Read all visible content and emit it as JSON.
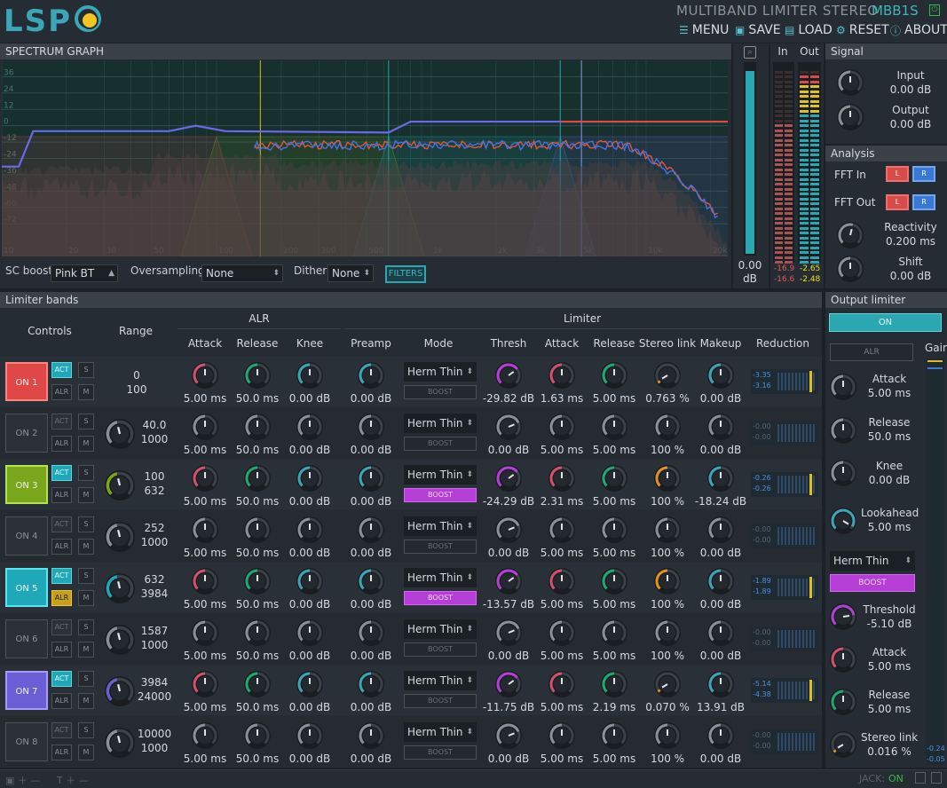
{
  "header": {
    "logo": "LSP",
    "plugin_title": "MULTIBAND LIMITER STEREO",
    "plugin_code": "MBB1S",
    "menu": [
      {
        "icon": "menu-icon",
        "label": "MENU"
      },
      {
        "icon": "save-icon",
        "label": "SAVE"
      },
      {
        "icon": "load-icon",
        "label": "LOAD"
      },
      {
        "icon": "reset-icon",
        "label": "RESET"
      },
      {
        "icon": "about-icon",
        "label": "ABOUT"
      }
    ]
  },
  "spectrum": {
    "title": "SPECTRUM GRAPH",
    "db_ticks": [
      "36",
      "24",
      "12",
      "0",
      "-12",
      "-24",
      "-36",
      "-48",
      "-60",
      "-72"
    ],
    "freq_ticks": [
      "10",
      "20",
      "30",
      "50",
      "100",
      "200",
      "300",
      "500",
      "1k",
      "2k",
      "3k",
      "5k",
      "10k",
      "20k"
    ],
    "sc_boost_label": "SC boost:",
    "sc_boost_value": "Pink BT",
    "oversampling_label": "Oversampling:",
    "oversampling_value": "None",
    "dither_label": "Dither:",
    "dither_value": "None",
    "filters_label": "FILTERS",
    "level_value": "0.00",
    "level_unit": "dB"
  },
  "meters": {
    "in_label": "In",
    "out_label": "Out",
    "in_peaks": [
      "-16.9",
      "-16.6"
    ],
    "out_peaks": [
      "-2.65",
      "-2.48"
    ]
  },
  "signal": {
    "title": "Signal",
    "input_label": "Input",
    "input_value": "0.00 dB",
    "output_label": "Output",
    "output_value": "0.00 dB"
  },
  "analysis": {
    "title": "Analysis",
    "fft_in_label": "FFT In",
    "fft_out_label": "FFT Out",
    "l_label": "L",
    "r_label": "R",
    "reactivity_label": "Reactivity",
    "reactivity_value": "0.200 ms",
    "shift_label": "Shift",
    "shift_value": "0.00 dB"
  },
  "bands": {
    "title": "Limiter bands",
    "col_controls": "Controls",
    "col_range": "Range",
    "group_alr": "ALR",
    "group_limiter": "Limiter",
    "cols": [
      "Attack",
      "Release",
      "Knee",
      "Preamp",
      "Mode",
      "Thresh",
      "Attack",
      "Release",
      "Stereo link",
      "Makeup",
      "Reduction"
    ],
    "act_label": "ACT",
    "alr_label": "ALR",
    "s_label": "S",
    "m_label": "M",
    "boost_label": "BOOST",
    "rows": [
      {
        "on": "ON 1",
        "active": true,
        "color": "#e04848",
        "range_hi": "0",
        "range_lo": "100",
        "range_knob": false,
        "alr_attack": "5.00 ms",
        "alr_release": "50.0 ms",
        "alr_knee": "0.00 dB",
        "preamp": "0.00 dB",
        "mode": "Herm Thin",
        "boost": false,
        "thresh": "-29.82 dB",
        "attack": "1.63 ms",
        "release": "5.00 ms",
        "stereo_link": "0.763 %",
        "makeup": "0.00 dB",
        "red_l": "-3.35",
        "red_r": "-3.16",
        "act_color": "#1fa8b8",
        "alr_active": false
      },
      {
        "on": "ON 2",
        "active": false,
        "color": "#3a4148",
        "range_hi": "40.0",
        "range_lo": "1000",
        "range_knob": true,
        "alr_attack": "5.00 ms",
        "alr_release": "50.0 ms",
        "alr_knee": "0.00 dB",
        "preamp": "0.00 dB",
        "mode": "Herm Thin",
        "boost": false,
        "thresh": "0.00 dB",
        "attack": "5.00 ms",
        "release": "5.00 ms",
        "stereo_link": "100 %",
        "makeup": "0.00 dB",
        "red_l": "-0.00",
        "red_r": "-0.00",
        "act_color": "#2b3137",
        "alr_active": false
      },
      {
        "on": "ON 3",
        "active": true,
        "color": "#7aa61c",
        "range_hi": "100",
        "range_lo": "632",
        "range_knob": true,
        "alr_attack": "5.00 ms",
        "alr_release": "50.0 ms",
        "alr_knee": "0.00 dB",
        "preamp": "0.00 dB",
        "mode": "Herm Thin",
        "boost": true,
        "thresh": "-24.29 dB",
        "attack": "2.31 ms",
        "release": "5.00 ms",
        "stereo_link": "100 %",
        "makeup": "-18.24 dB",
        "red_l": "-0.26",
        "red_r": "-0.26",
        "act_color": "#1fa8b8",
        "alr_active": false
      },
      {
        "on": "ON 4",
        "active": false,
        "color": "#3a4148",
        "range_hi": "252",
        "range_lo": "1000",
        "range_knob": true,
        "alr_attack": "5.00 ms",
        "alr_release": "50.0 ms",
        "alr_knee": "0.00 dB",
        "preamp": "0.00 dB",
        "mode": "Herm Thin",
        "boost": false,
        "thresh": "0.00 dB",
        "attack": "5.00 ms",
        "release": "5.00 ms",
        "stereo_link": "100 %",
        "makeup": "0.00 dB",
        "red_l": "-0.00",
        "red_r": "-0.00",
        "act_color": "#2b3137",
        "alr_active": false
      },
      {
        "on": "ON 5",
        "active": true,
        "color": "#1fa8b8",
        "range_hi": "632",
        "range_lo": "3984",
        "range_knob": true,
        "alr_attack": "5.00 ms",
        "alr_release": "50.0 ms",
        "alr_knee": "0.00 dB",
        "preamp": "0.00 dB",
        "mode": "Herm Thin",
        "boost": true,
        "thresh": "-13.57 dB",
        "attack": "5.00 ms",
        "release": "5.00 ms",
        "stereo_link": "100 %",
        "makeup": "0.00 dB",
        "red_l": "-1.89",
        "red_r": "-1.89",
        "act_color": "#1fa8b8",
        "alr_active": true
      },
      {
        "on": "ON 6",
        "active": false,
        "color": "#3a4148",
        "range_hi": "1587",
        "range_lo": "1000",
        "range_knob": true,
        "alr_attack": "5.00 ms",
        "alr_release": "50.0 ms",
        "alr_knee": "0.00 dB",
        "preamp": "0.00 dB",
        "mode": "Herm Thin",
        "boost": false,
        "thresh": "0.00 dB",
        "attack": "5.00 ms",
        "release": "5.00 ms",
        "stereo_link": "100 %",
        "makeup": "0.00 dB",
        "red_l": "-0.00",
        "red_r": "-0.00",
        "act_color": "#2b3137",
        "alr_active": false
      },
      {
        "on": "ON 7",
        "active": true,
        "color": "#6a5ed4",
        "range_hi": "3984",
        "range_lo": "24000",
        "range_knob": true,
        "alr_attack": "5.00 ms",
        "alr_release": "50.0 ms",
        "alr_knee": "0.00 dB",
        "preamp": "0.00 dB",
        "mode": "Herm Thin",
        "boost": false,
        "thresh": "-11.75 dB",
        "attack": "5.00 ms",
        "release": "2.19 ms",
        "stereo_link": "0.070 %",
        "makeup": "13.91 dB",
        "red_l": "-5.14",
        "red_r": "-4.38",
        "act_color": "#1fa8b8",
        "alr_active": false
      },
      {
        "on": "ON 8",
        "active": false,
        "color": "#3a4148",
        "range_hi": "10000",
        "range_lo": "1000",
        "range_knob": true,
        "alr_attack": "5.00 ms",
        "alr_release": "50.0 ms",
        "alr_knee": "0.00 dB",
        "preamp": "0.00 dB",
        "mode": "Herm Thin",
        "boost": false,
        "thresh": "0.00 dB",
        "attack": "5.00 ms",
        "release": "5.00 ms",
        "stereo_link": "100 %",
        "makeup": "0.00 dB",
        "red_l": "-0.00",
        "red_r": "-0.00",
        "act_color": "#2b3137",
        "alr_active": false
      }
    ]
  },
  "output_limiter": {
    "title": "Output limiter",
    "on_label": "ON",
    "alr_label": "ALR",
    "gain_label": "Gain",
    "alr_attack_label": "Attack",
    "alr_attack_value": "5.00 ms",
    "alr_release_label": "Release",
    "alr_release_value": "50.0 ms",
    "alr_knee_label": "Knee",
    "alr_knee_value": "0.00 dB",
    "lookahead_label": "Lookahead",
    "lookahead_value": "5.00 ms",
    "mode": "Herm Thin",
    "boost_label": "BOOST",
    "threshold_label": "Threshold",
    "threshold_value": "-5.10 dB",
    "attack_label": "Attack",
    "attack_value": "5.00 ms",
    "release_label": "Release",
    "release_value": "5.00 ms",
    "stereo_link_label": "Stereo link",
    "stereo_link_value": "0.016 %",
    "gain_l": "-0.24",
    "gain_r": "-0.05"
  },
  "footer": {
    "jack_label": "JACK:",
    "jack_status": "ON"
  },
  "colors": {
    "teal": "#2aa7b0",
    "pink": "#d2506e",
    "green": "#1fa870",
    "cyan": "#3aa6b8",
    "purple": "#b43ed6",
    "orange": "#e0921c"
  }
}
